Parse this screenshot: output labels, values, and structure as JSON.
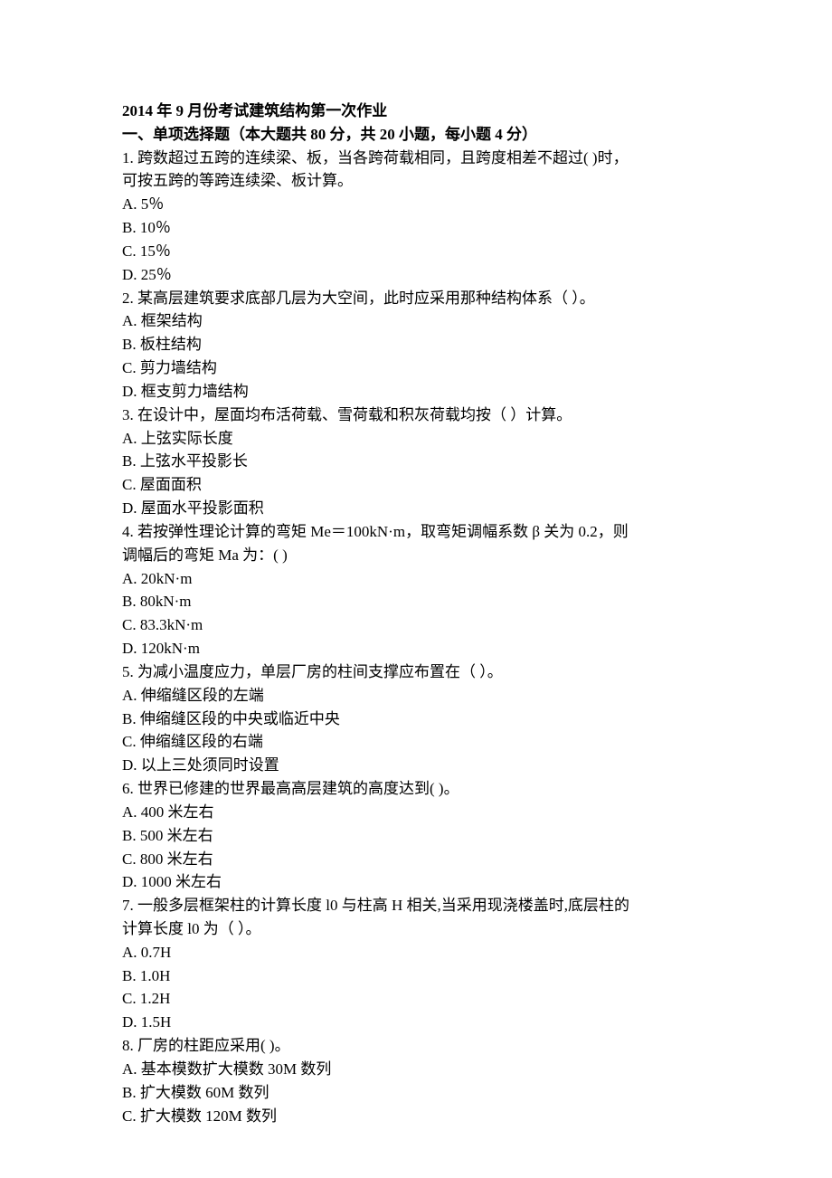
{
  "title": "2014 年 9 月份考试建筑结构第一次作业",
  "section": "一、单项选择题（本大题共 80 分，共 20 小题，每小题 4 分）",
  "questions": [
    {
      "stem": [
        "1. 跨数超过五跨的连续梁、板，当各跨荷载相同，且跨度相差不超过( )时，",
        "可按五跨的等跨连续梁、板计算。"
      ],
      "options": [
        "A. 5％",
        "B. 10％",
        "C. 15％",
        "D. 25％"
      ]
    },
    {
      "stem": [
        "2. 某高层建筑要求底部几层为大空间，此时应采用那种结构体系（ ）。"
      ],
      "options": [
        "A. 框架结构",
        "B. 板柱结构",
        "C. 剪力墙结构",
        "D. 框支剪力墙结构"
      ]
    },
    {
      "stem": [
        "3. 在设计中，屋面均布活荷载、雪荷载和积灰荷载均按（ ）计算。"
      ],
      "options": [
        "A. 上弦实际长度",
        "B. 上弦水平投影长",
        "C. 屋面面积",
        "D. 屋面水平投影面积"
      ]
    },
    {
      "stem": [
        "4. 若按弹性理论计算的弯矩 Me＝100kN·m，取弯矩调幅系数 β 关为 0.2，则",
        "调幅后的弯矩 Ma 为：( )"
      ],
      "options": [
        "A. 20kN·m",
        "B. 80kN·m",
        "C. 83.3kN·m",
        "D. 120kN·m"
      ]
    },
    {
      "stem": [
        "5. 为减小温度应力，单层厂房的柱间支撑应布置在（ ）。"
      ],
      "options": [
        "A. 伸缩缝区段的左端",
        "B. 伸缩缝区段的中央或临近中央",
        "C. 伸缩缝区段的右端",
        "D. 以上三处须同时设置"
      ]
    },
    {
      "stem": [
        "6. 世界已修建的世界最高高层建筑的高度达到( )。"
      ],
      "options": [
        "A. 400 米左右",
        "B. 500 米左右",
        "C. 800 米左右",
        "D. 1000 米左右"
      ]
    },
    {
      "stem": [
        "7. 一般多层框架柱的计算长度 l0 与柱高 H 相关,当采用现浇楼盖时,底层柱的",
        "计算长度 l0 为（ ）。"
      ],
      "options": [
        "A. 0.7H",
        "B. 1.0H",
        "C. 1.2H",
        "D. 1.5H"
      ]
    },
    {
      "stem": [
        "8. 厂房的柱距应采用( )。"
      ],
      "options": [
        "A. 基本模数扩大模数 30M 数列",
        "B. 扩大模数 60M 数列",
        "C. 扩大模数 120M 数列"
      ]
    }
  ]
}
